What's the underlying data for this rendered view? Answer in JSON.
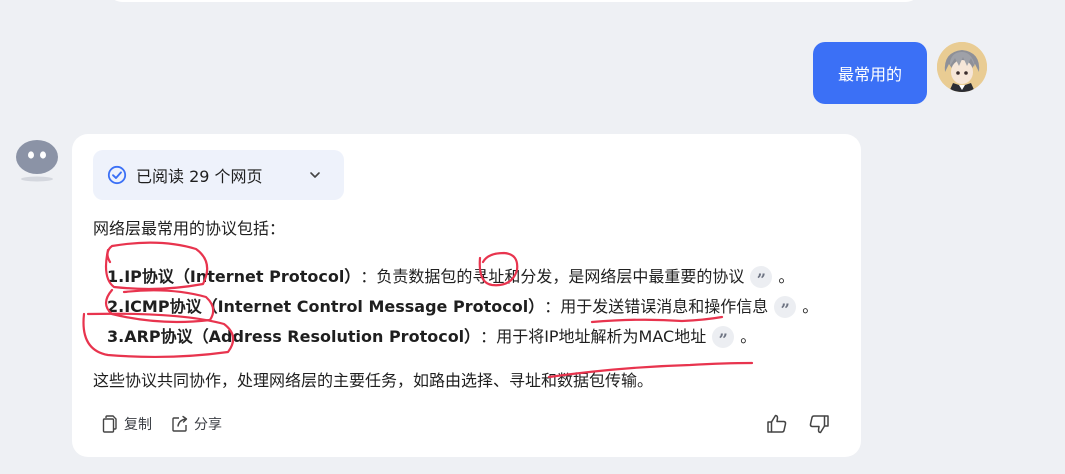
{
  "user_message": {
    "text": "最常用的"
  },
  "answer": {
    "read_status": "已阅读 29 个网页",
    "intro": "网络层最常用的协议包括：",
    "items": [
      {
        "num": "1. ",
        "name": "IP协议",
        "full": "（Internet Protocol）",
        "sep": "：",
        "desc": "负责数据包的寻址和分发，是网络层中最重要的协议",
        "end": "。"
      },
      {
        "num": "2. ",
        "name": "ICMP协议",
        "full": "（Internet Control Message Protocol）",
        "sep": "：",
        "desc": "用于发送错误消息和操作信息",
        "end": "。"
      },
      {
        "num": "3. ",
        "name": "ARP协议",
        "full": "（Address Resolution Protocol）",
        "sep": "：",
        "desc": "用于将IP地址解析为MAC地址",
        "end": "。"
      }
    ],
    "summary": "这些协议共同协作，处理网络层的主要任务，如路由选择、寻址和数据包传输。",
    "actions": {
      "copy": "复制",
      "share": "分享"
    }
  },
  "colors": {
    "accent": "#3b70f6",
    "annotation": "#e8344e",
    "background": "#eef0f4"
  },
  "icons": [
    "check-circle-icon",
    "chevron-down-icon",
    "quote-icon",
    "copy-icon",
    "share-icon",
    "thumbs-up-icon",
    "thumbs-down-icon"
  ]
}
